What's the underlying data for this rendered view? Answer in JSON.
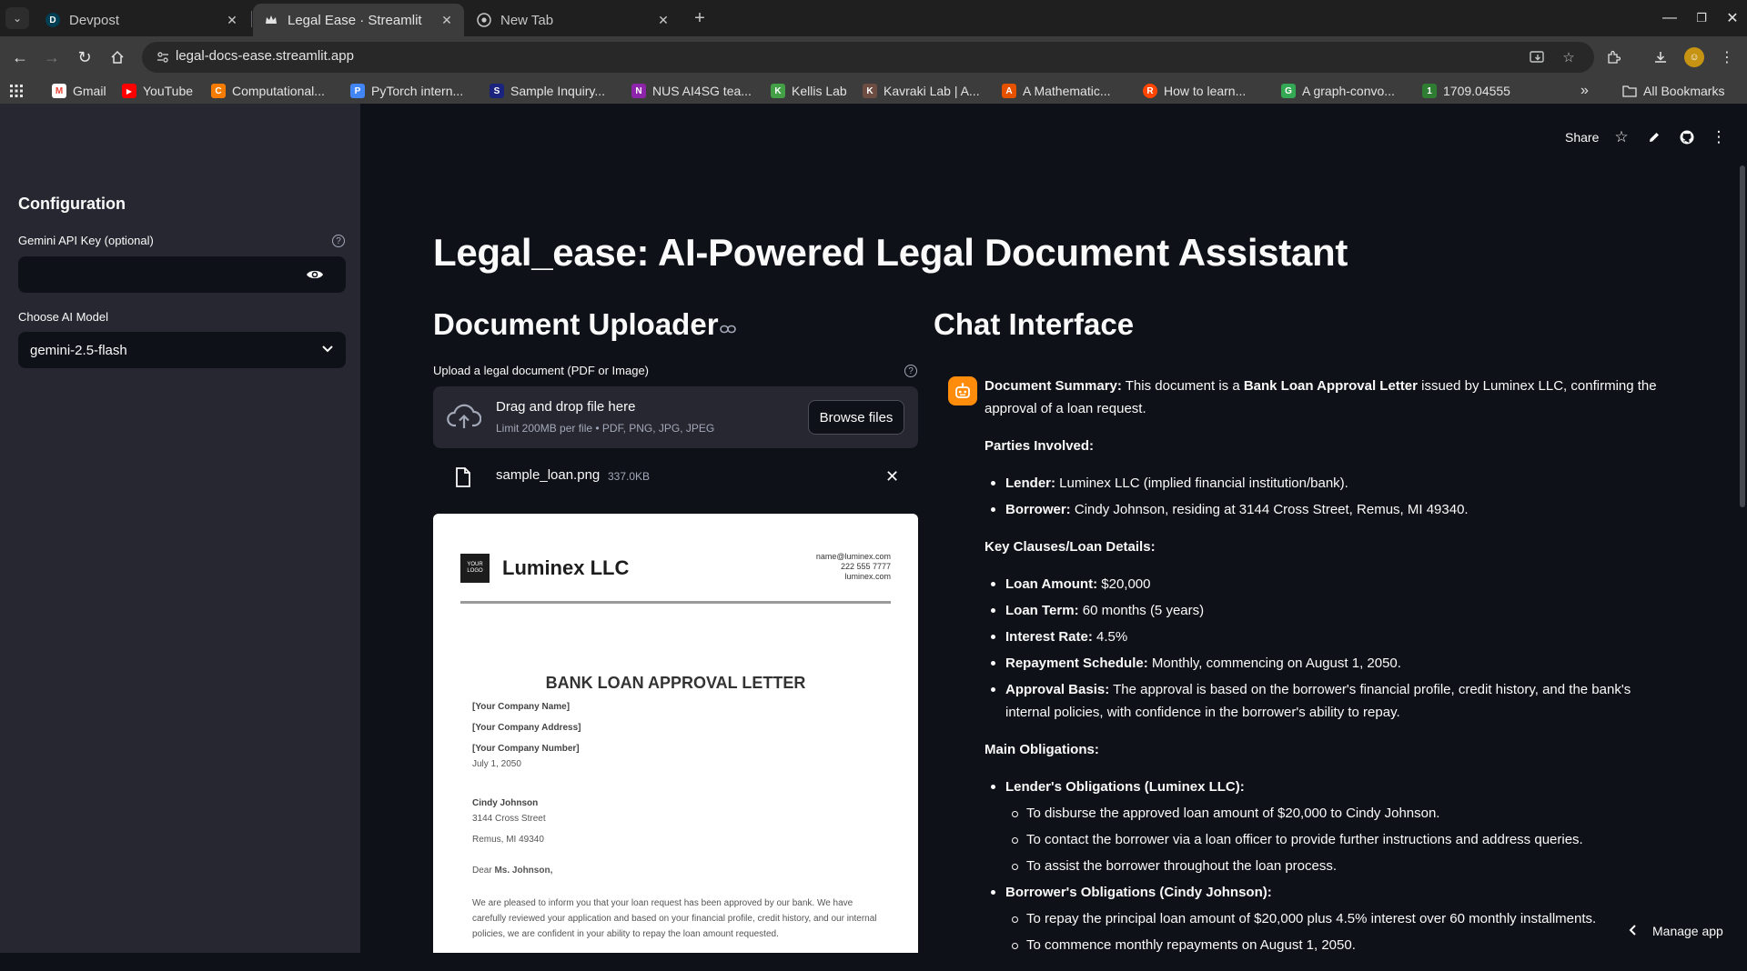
{
  "browser": {
    "tabs": [
      {
        "title": "Devpost",
        "favicon": "D",
        "active": false
      },
      {
        "title": "Legal Ease · Streamlit",
        "favicon": "crown",
        "active": true
      },
      {
        "title": "New Tab",
        "favicon": "chrome",
        "active": false
      }
    ],
    "url": "legal-docs-ease.streamlit.app",
    "bookmarks": [
      {
        "label": "Gmail",
        "icon": "M",
        "color": "#ea4335"
      },
      {
        "label": "YouTube",
        "icon": "▶",
        "color": "#ff0000"
      },
      {
        "label": "Computational...",
        "icon": "C",
        "color": "#f57c00"
      },
      {
        "label": "PyTorch intern...",
        "icon": "P",
        "color": "#4285f4"
      },
      {
        "label": "Sample Inquiry...",
        "icon": "S",
        "color": "#1a237e"
      },
      {
        "label": "NUS AI4SG tea...",
        "icon": "N",
        "color": "#8e24aa"
      },
      {
        "label": "Kellis Lab",
        "icon": "K",
        "color": "#43a047"
      },
      {
        "label": "Kavraki Lab | A...",
        "icon": "K",
        "color": "#6d4c41"
      },
      {
        "label": "A Mathematic...",
        "icon": "A",
        "color": "#e65100"
      },
      {
        "label": "How to learn...",
        "icon": "R",
        "color": "#ff4500"
      },
      {
        "label": "A graph-convo...",
        "icon": "G",
        "color": "#34a853"
      },
      {
        "label": "1709.04555",
        "icon": "1",
        "color": "#2e7d32"
      }
    ],
    "all_bookmarks": "All Bookmarks"
  },
  "sidebar": {
    "title": "Configuration",
    "api_key_label": "Gemini API Key (optional)",
    "api_key_value": "",
    "model_label": "Choose AI Model",
    "model_value": "gemini-2.5-flash"
  },
  "header": {
    "share": "Share"
  },
  "main": {
    "title": "Legal_ease: AI-Powered Legal Document Assistant",
    "uploader": {
      "heading": "Document Uploader",
      "label": "Upload a legal document (PDF or Image)",
      "drop_text": "Drag and drop file here",
      "limit_text": "Limit 200MB per file • PDF, PNG, JPG, JPEG",
      "browse_label": "Browse files",
      "file_name": "sample_loan.png",
      "file_size": "337.0KB"
    },
    "preview": {
      "logo_text": "YOUR LOGO",
      "company": "Luminex LLC",
      "contact": [
        "name@luminex.com",
        "222 555 7777",
        "luminex.com"
      ],
      "heading": "BANK LOAN APPROVAL LETTER",
      "lines": [
        {
          "text": "[Your Company Name]",
          "bold": true
        },
        {
          "text": "[Your Company Address]",
          "bold": true
        },
        {
          "text": "[Your Company Number]",
          "bold": true
        },
        {
          "text": "July 1, 2050",
          "bold": false
        },
        {
          "text": "Cindy Johnson",
          "bold": true
        },
        {
          "text": "3144 Cross Street",
          "bold": false
        },
        {
          "text": "Remus, MI 49340",
          "bold": false
        }
      ],
      "salutation_prefix": "Dear ",
      "salutation_name": "Ms. Johnson,",
      "paragraph": "We are pleased to inform you that your loan request has been approved by our bank. We have carefully reviewed your application and based on your financial profile, credit history, and our internal policies, we are confident in your ability to repay the loan amount requested."
    },
    "chat": {
      "heading": "Chat Interface",
      "summary_label": "Document Summary:",
      "summary_pre": " This document is a ",
      "summary_bold": "Bank Loan Approval Letter",
      "summary_post": " issued by Luminex LLC, confirming the approval of a loan request.",
      "parties_heading": "Parties Involved:",
      "parties": [
        {
          "label": "Lender:",
          "text": " Luminex LLC (implied financial institution/bank)."
        },
        {
          "label": "Borrower:",
          "text": " Cindy Johnson, residing at 3144 Cross Street, Remus, MI 49340."
        }
      ],
      "clauses_heading": "Key Clauses/Loan Details:",
      "clauses": [
        {
          "label": "Loan Amount:",
          "text": " $20,000"
        },
        {
          "label": "Loan Term:",
          "text": " 60 months (5 years)"
        },
        {
          "label": "Interest Rate:",
          "text": " 4.5%"
        },
        {
          "label": "Repayment Schedule:",
          "text": " Monthly, commencing on August 1, 2050."
        },
        {
          "label": "Approval Basis:",
          "text": " The approval is based on the borrower's financial profile, credit history, and the bank's internal policies, with confidence in the borrower's ability to repay."
        }
      ],
      "obligations_heading": "Main Obligations:",
      "lender_obligations_label": "Lender's Obligations (Luminex LLC):",
      "lender_obligations": [
        "To disburse the approved loan amount of $20,000 to Cindy Johnson.",
        "To contact the borrower via a loan officer to provide further instructions and address queries.",
        "To assist the borrower throughout the loan process."
      ],
      "borrower_obligations_label": "Borrower's Obligations (Cindy Johnson):",
      "borrower_obligations": [
        "To repay the principal loan amount of $20,000 plus 4.5% interest over 60 monthly installments.",
        "To commence monthly repayments on August 1, 2050."
      ]
    }
  },
  "manage_app": "Manage app",
  "colors": {
    "bot_avatar": "#ff8c0a",
    "sidebar_bg": "#262730",
    "main_bg": "#0e1117"
  }
}
